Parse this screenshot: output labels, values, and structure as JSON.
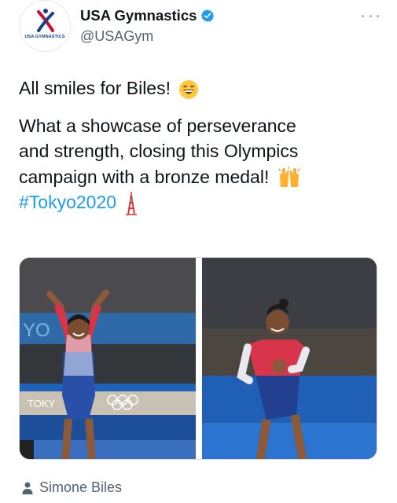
{
  "account": {
    "display_name": "USA Gymnastics",
    "handle": "@USAGym",
    "verified": true,
    "avatar_logo_text": "USA GYMNASTICS"
  },
  "tweet": {
    "line1": "All smiles for Biles!",
    "line2": "What a showcase of perseverance",
    "line3": "and strength, closing this Olympics",
    "line4": "campaign with a bronze medal!",
    "hashtag": "#Tokyo2020",
    "emojis": [
      "grinning-face-icon",
      "raising-hands-icon",
      "tokyo-tower-icon"
    ]
  },
  "media": {
    "photo_count": 2,
    "photo1_sign_text": "TOKY",
    "photo1_banner_text": "YO"
  },
  "tagged": {
    "name": "Simone Biles",
    "icon": "person-icon"
  },
  "colors": {
    "link": "#1d9bf0",
    "verified_badge": "#1d9bf0",
    "secondary_text": "#536471"
  }
}
